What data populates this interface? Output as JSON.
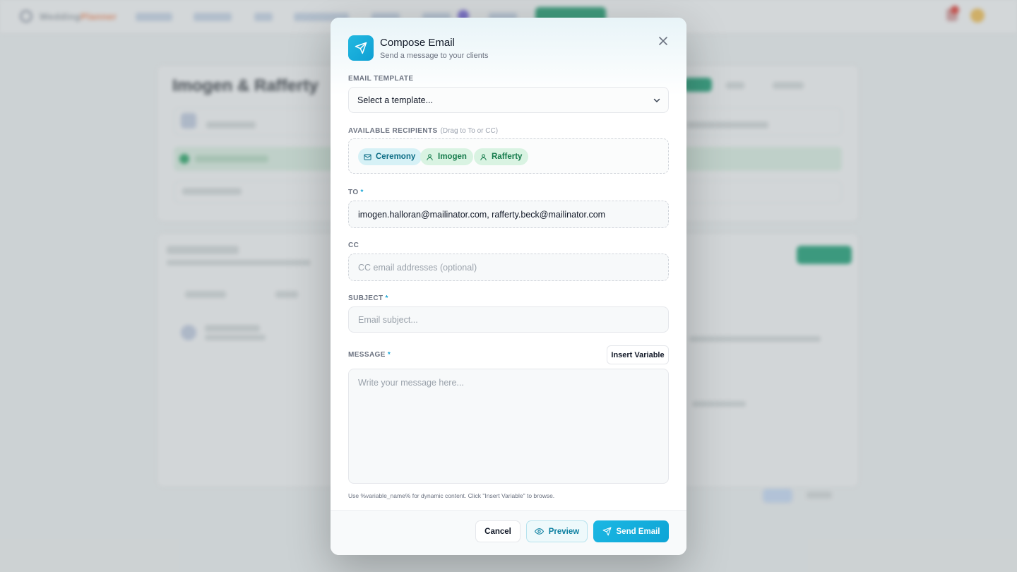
{
  "background": {
    "app_name": "Wedding",
    "app_name_accent": "Planner",
    "page_title": "Imogen & Rafferty"
  },
  "modal": {
    "title": "Compose Email",
    "subtitle": "Send a message to your clients",
    "template": {
      "label": "EMAIL TEMPLATE",
      "value": "Select a template..."
    },
    "recipients": {
      "label": "AVAILABLE RECIPIENTS",
      "hint": "(Drag to To or CC)",
      "chips": [
        {
          "label": "Ceremony",
          "icon": "mail-icon"
        },
        {
          "label": "Imogen",
          "icon": "person-icon"
        },
        {
          "label": "Rafferty",
          "icon": "person-icon"
        }
      ]
    },
    "to": {
      "label": "TO",
      "required_mark": "*",
      "value": "imogen.halloran@mailinator.com, rafferty.beck@mailinator.com"
    },
    "cc": {
      "label": "CC",
      "placeholder": "CC email addresses (optional)"
    },
    "subject": {
      "label": "SUBJECT",
      "required_mark": "*",
      "placeholder": "Email subject..."
    },
    "message": {
      "label": "MESSAGE",
      "required_mark": "*",
      "placeholder": "Write your message here...",
      "insert_variable_label": "Insert Variable",
      "help_text": "Use %variable_name% for dynamic content. Click \"Insert Variable\" to browse."
    },
    "footer": {
      "cancel_label": "Cancel",
      "preview_label": "Preview",
      "send_label": "Send Email"
    }
  },
  "colors": {
    "accent": "#0ea5d6",
    "chip_mail_bg": "#d6f1f6",
    "chip_person_bg": "#d9f3e2"
  }
}
